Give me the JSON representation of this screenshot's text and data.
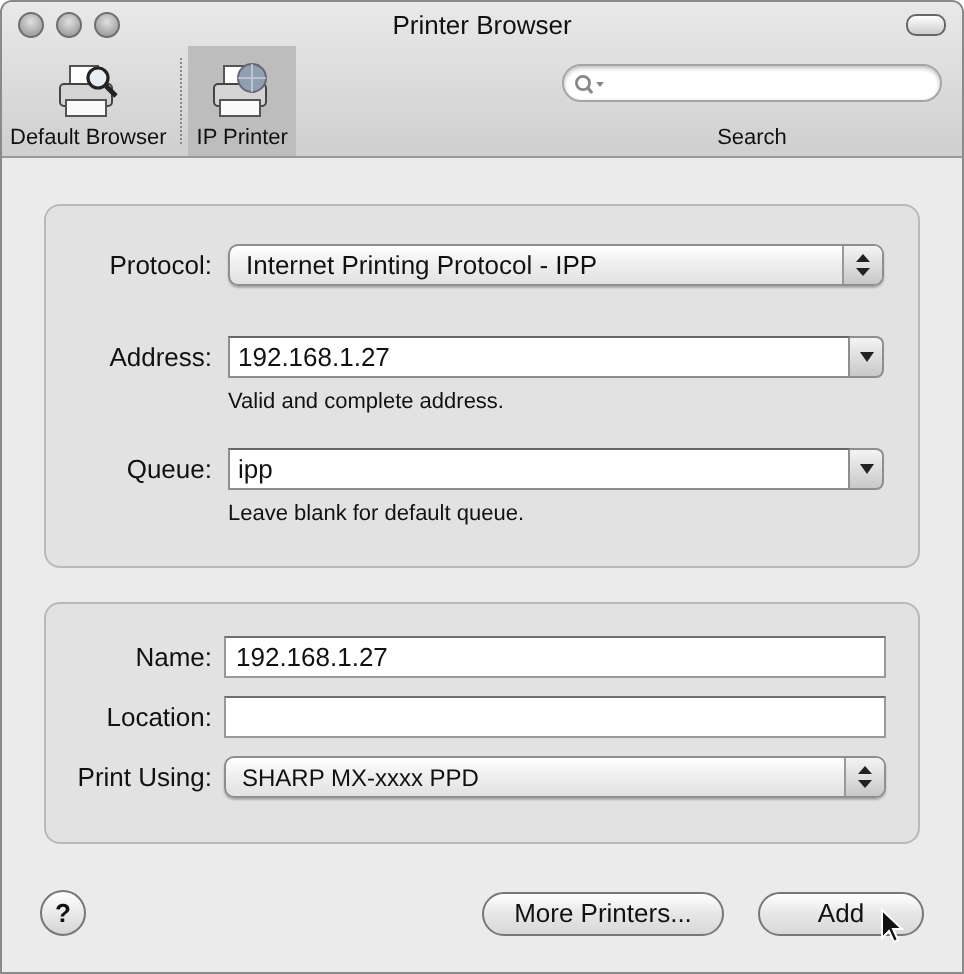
{
  "window": {
    "title": "Printer Browser"
  },
  "toolbar": {
    "items": [
      {
        "label": "Default Browser",
        "selected": false,
        "kind": "browse"
      },
      {
        "label": "IP Printer",
        "selected": true,
        "kind": "ip"
      }
    ],
    "search": {
      "label": "Search"
    }
  },
  "connection": {
    "fields": [
      {
        "kind": "popup",
        "label": "Protocol:",
        "value": "Internet Printing Protocol - IPP"
      },
      {
        "kind": "combo",
        "label": "Address:",
        "value": "192.168.1.27",
        "hint": "Valid and complete address."
      },
      {
        "kind": "combo",
        "label": "Queue:",
        "value": "ipp",
        "hint": "Leave blank for default queue."
      }
    ]
  },
  "details": {
    "fields": [
      {
        "kind": "text",
        "label": "Name:",
        "value": "192.168.1.27"
      },
      {
        "kind": "text",
        "label": "Location:"
      },
      {
        "kind": "popup",
        "label": "Print Using:",
        "value": "SHARP MX-xxxx PPD"
      }
    ]
  },
  "help_button": "?",
  "buttons": [
    {
      "label": "More Printers..."
    },
    {
      "label": "Add"
    }
  ]
}
